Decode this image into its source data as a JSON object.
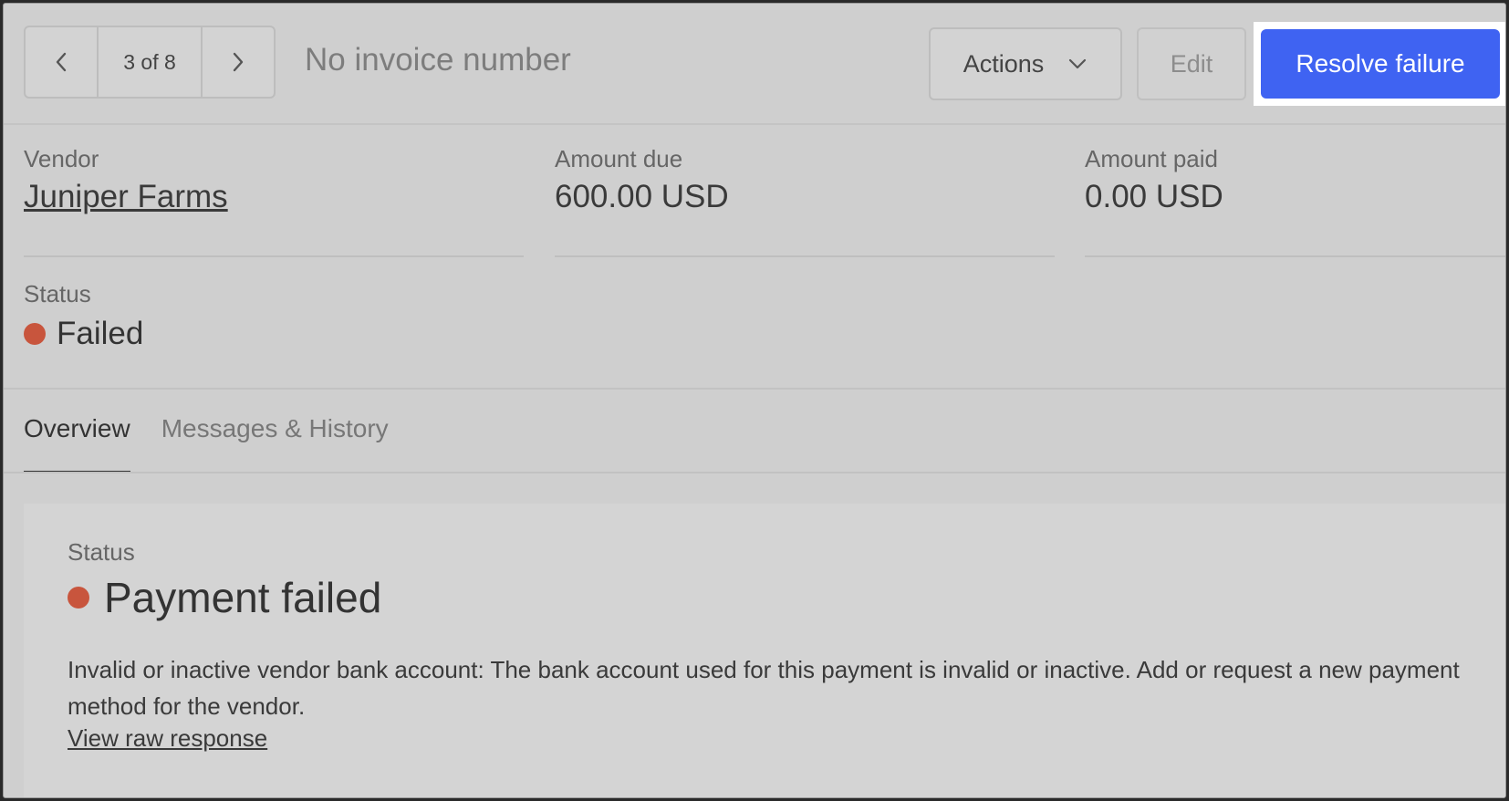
{
  "header": {
    "pager_count": "3 of 8",
    "invoice_title": "No invoice number",
    "actions_label": "Actions",
    "edit_label": "Edit",
    "resolve_label": "Resolve failure"
  },
  "summary": {
    "vendor_label": "Vendor",
    "vendor_value": "Juniper Farms",
    "amount_due_label": "Amount due",
    "amount_due_value": "600.00 USD",
    "amount_paid_label": "Amount paid",
    "amount_paid_value": "0.00 USD",
    "status_label": "Status",
    "status_value": "Failed"
  },
  "tabs": [
    {
      "label": "Overview",
      "active": true
    },
    {
      "label": "Messages & History",
      "active": false
    }
  ],
  "overview": {
    "status_label": "Status",
    "status_value": "Payment failed",
    "description": "Invalid or inactive vendor bank account: The bank account used for this payment is invalid or inactive. Add or request a new payment method for the vendor.",
    "raw_link": "View raw response"
  },
  "colors": {
    "primary": "#3f63f2",
    "failed": "#c8553d",
    "background": "#cfcfcf"
  },
  "icons": {
    "prev": "chevron-left-icon",
    "next": "chevron-right-icon",
    "actions": "chevron-down-icon",
    "status": "status-dot-icon"
  }
}
